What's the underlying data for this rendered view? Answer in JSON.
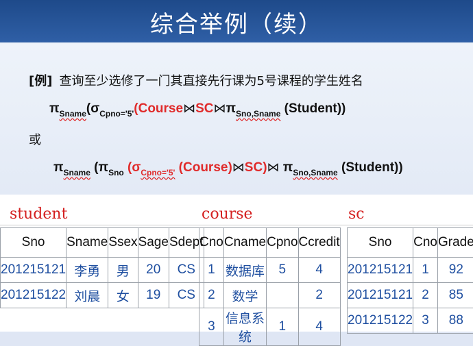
{
  "title": "综合举例（续）",
  "question": {
    "tag": "[例]",
    "text": "查询至少选修了一门其直接先行课为5号课程的学生姓名"
  },
  "expr1": {
    "pi": "π",
    "sub_sname": "Sname",
    "open": "(σ",
    "sub_cond": "Cpno='5'",
    "red_part": "(Course",
    "join1": "⋈",
    "sc": "SC",
    "join2": "⋈",
    "pi2": "π",
    "sub_proj": "Sno,Sname",
    "tail": " (Student))"
  },
  "or_text": "或",
  "expr2": {
    "pi": "π",
    "sub_sname": "Sname",
    "open": " (π",
    "sub_sno": "Sno",
    "red_open": " (σ",
    "sub_cond": "Cpno='5'",
    "red_course": " (Course)",
    "join1": "⋈",
    "red_sc": "SC)",
    "join2": "⋈",
    "pi2": " π",
    "sub_proj": "Sno,Sname",
    "tail": " (Student))"
  },
  "student": {
    "caption": "student",
    "headers": [
      "Sno",
      "Sname",
      "Ssex",
      "Sage",
      "Sdept"
    ],
    "rows": [
      [
        "201215121",
        "李勇",
        "男",
        "20",
        "CS"
      ],
      [
        "201215122",
        "刘晨",
        "女",
        "19",
        "CS"
      ]
    ]
  },
  "course": {
    "caption": "course",
    "headers": [
      "Cno",
      "Cname",
      "Cpno",
      "Ccredit"
    ],
    "rows": [
      [
        "1",
        "数据库",
        "5",
        "4"
      ],
      [
        "2",
        "数学",
        "",
        "2"
      ],
      [
        "3",
        "信息系统",
        "1",
        "4"
      ]
    ]
  },
  "sc": {
    "caption": "sc",
    "headers": [
      "Sno",
      "Cno",
      "Grade"
    ],
    "rows": [
      [
        "201215121",
        "1",
        "92"
      ],
      [
        "201215121",
        "2",
        "85"
      ],
      [
        "201215122",
        "3",
        "88"
      ]
    ]
  }
}
